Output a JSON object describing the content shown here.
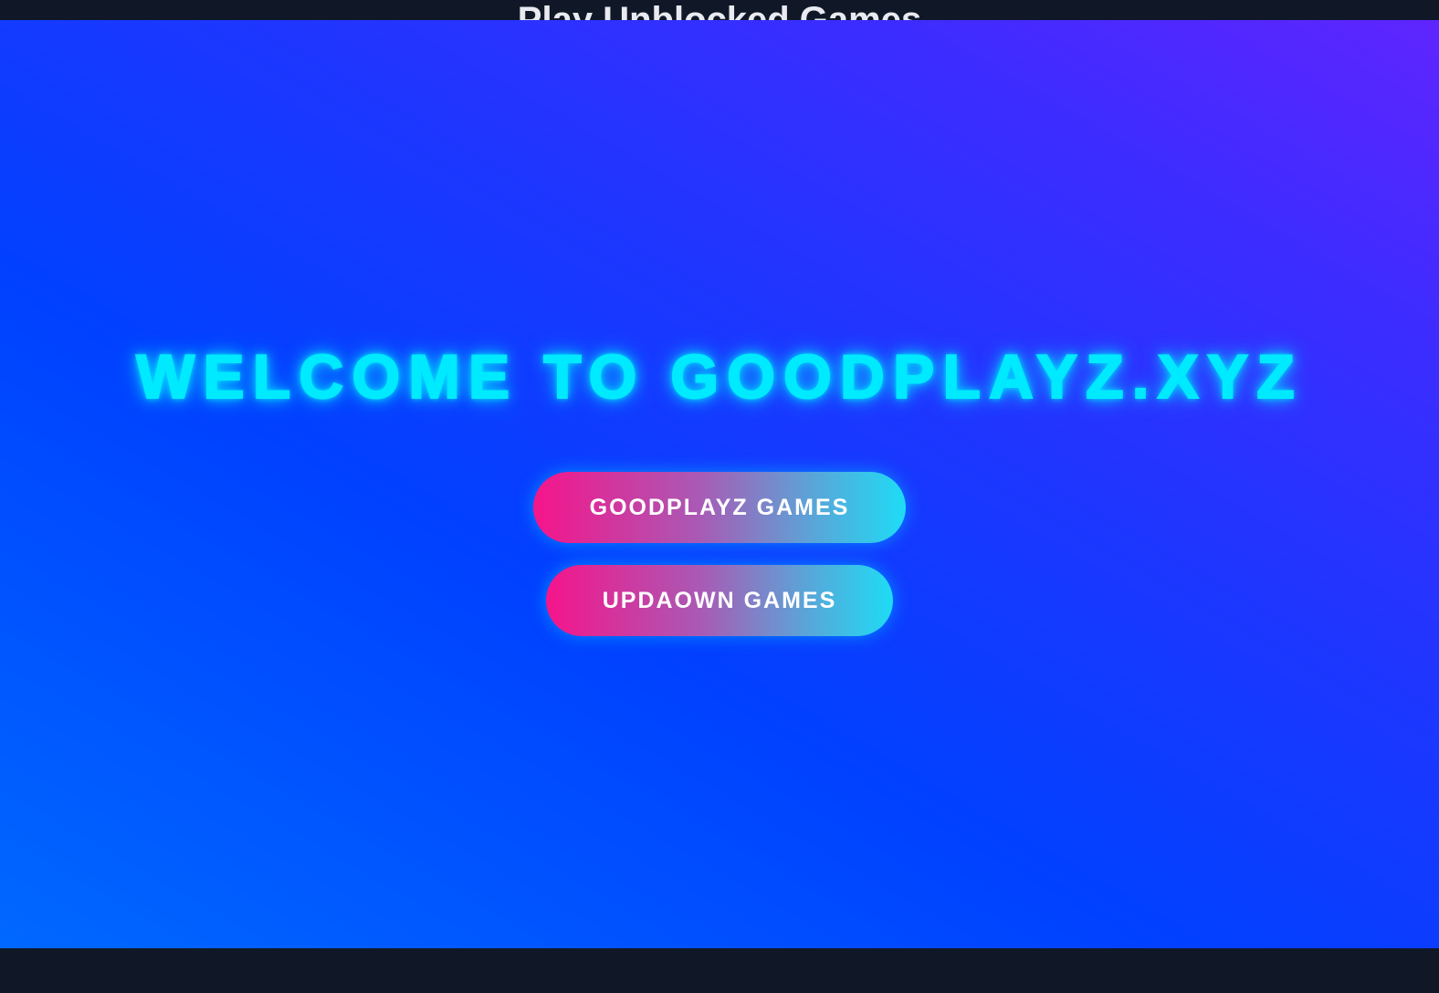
{
  "header": {
    "title": "Play Unblocked Games"
  },
  "hero": {
    "heading": "WELCOME TO GOODPLAYZ.XYZ",
    "buttons": [
      {
        "label": "GOODPLAYZ GAMES"
      },
      {
        "label": "UPDAOWN GAMES"
      }
    ]
  },
  "colors": {
    "page_background": "#101827",
    "heading_glow": "#00eaff",
    "button_gradient_start": "#f6148a",
    "button_gradient_end": "#1edcf5",
    "hero_gradient_start": "#0068ff",
    "hero_gradient_end": "#5f25ff"
  }
}
